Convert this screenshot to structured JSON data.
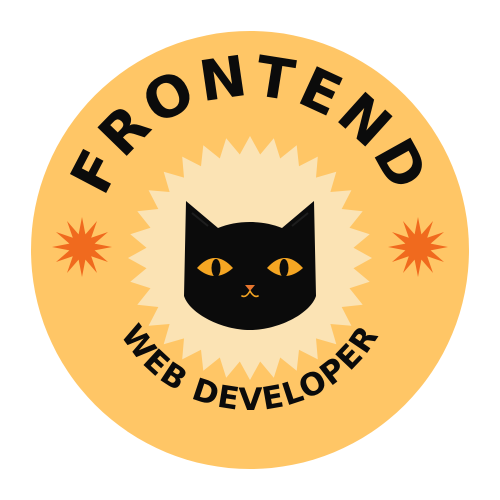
{
  "badge": {
    "top_text": "FRONTEND",
    "bottom_text": "WEB DEVELOPER",
    "mascot": "black-cat-icon",
    "ornaments": [
      "orange-starburst-icon",
      "orange-starburst-icon"
    ],
    "colors": {
      "badge_fill": "#FFC666",
      "sunburst_fill": "#FBE3B4",
      "text": "#0B0B0B",
      "cat": "#0B0B0B",
      "cat_eyes": "#F5A623",
      "cat_nose": "#E8762E",
      "starburst": "#F06A1E"
    }
  }
}
